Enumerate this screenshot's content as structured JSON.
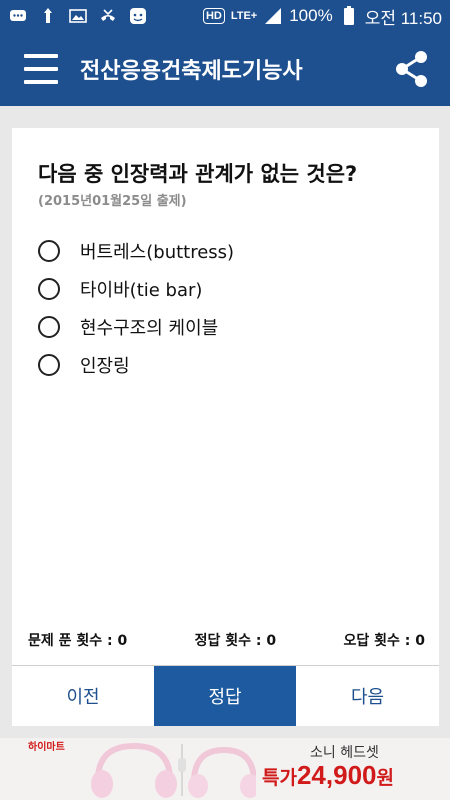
{
  "status_bar": {
    "battery": "100%",
    "time": "오전 11:50",
    "hd_label": "HD",
    "network": "LTE+"
  },
  "app_bar": {
    "title": "전산응용건축제도기능사"
  },
  "question": {
    "text": "다음 중 인장력과 관계가 없는 것은?",
    "date": "(2015년01월25일 출제)",
    "options": [
      {
        "label": "버트레스(buttress)",
        "selected": false
      },
      {
        "label": "타이바(tie bar)",
        "selected": false
      },
      {
        "label": "현수구조의 케이블",
        "selected": false
      },
      {
        "label": "인장링",
        "selected": false
      }
    ]
  },
  "stats": {
    "solved": "문제 푼 횟수 : 0",
    "correct": "정답 횟수 : 0",
    "wrong": "오답 횟수 : 0"
  },
  "buttons": {
    "prev": "이전",
    "answer": "정답",
    "next": "다음"
  },
  "ad": {
    "brand": "하이마트",
    "title": "소니 헤드셋",
    "price_prefix": "특가",
    "price_number": "24,900",
    "price_unit": "원"
  },
  "colors": {
    "primary": "#1e4f8f",
    "button_active": "#1e5aa0",
    "ad_price": "#d11a1a"
  }
}
